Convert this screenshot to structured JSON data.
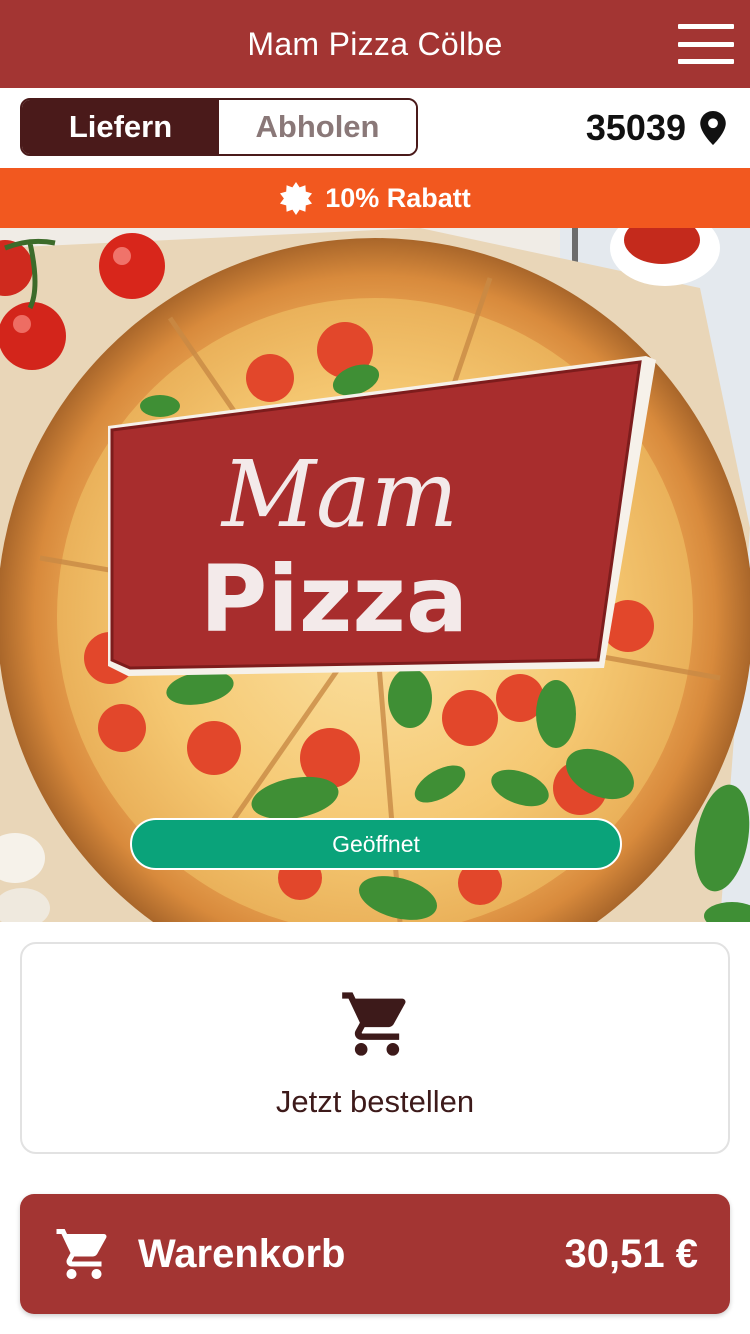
{
  "header": {
    "title": "Mam Pizza Cölbe",
    "menu_icon": "hamburger-menu-icon"
  },
  "delivery": {
    "mode_deliver": "Liefern",
    "mode_pickup": "Abholen",
    "active_mode": "Liefern",
    "postcode": "35039",
    "location_icon": "map-pin-icon"
  },
  "promo": {
    "text": "10% Rabatt",
    "icon": "badge-icon"
  },
  "hero": {
    "logo_line1": "Mam",
    "logo_line2": "Pizza",
    "status": "Geöffnet"
  },
  "order": {
    "label": "Jetzt bestellen",
    "icon": "shopping-cart-icon"
  },
  "cart": {
    "label": "Warenkorb",
    "total": "30,51 €",
    "icon": "shopping-cart-icon"
  },
  "colors": {
    "brand": "#a33533",
    "dark": "#4a1a1a",
    "promo": "#f2581f",
    "status_open": "#0aa37a"
  }
}
